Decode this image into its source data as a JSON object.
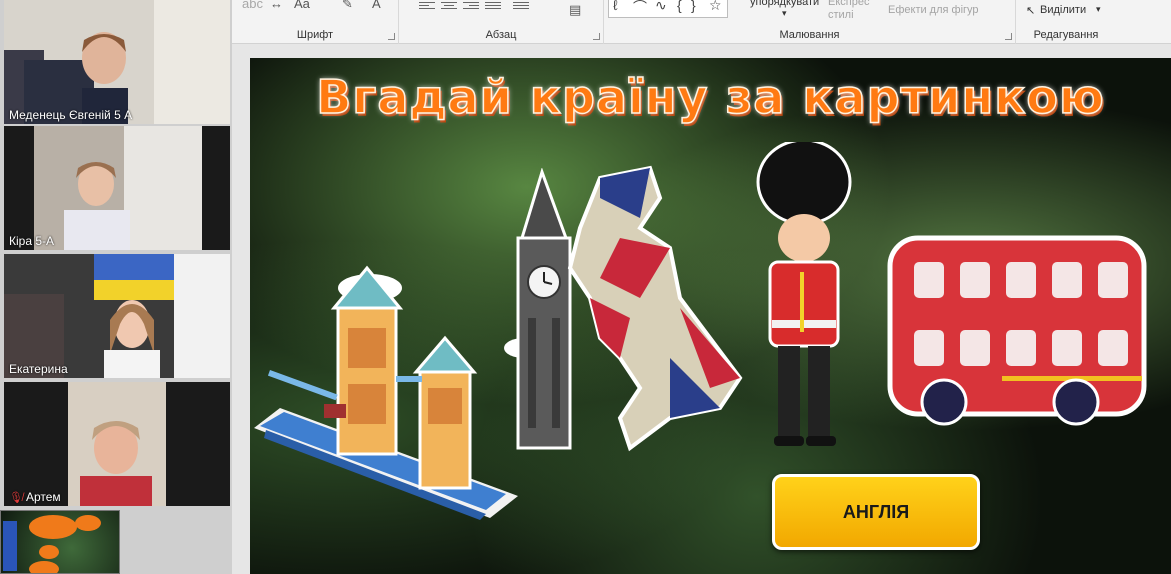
{
  "ribbon": {
    "groups": {
      "font": "Шрифт",
      "paragraph": "Абзац",
      "drawing": "Малювання",
      "editing": "Редагування"
    },
    "tools": {
      "font_case": "Aa",
      "font_color": "A",
      "arrange_label": "упорядкувати",
      "quick_styles": "Експрес стилі",
      "shape_effects": "Ефекти для фігур",
      "select": "Виділити"
    }
  },
  "participants": [
    {
      "name": "Меденець Євгеній 5 А",
      "muted": false
    },
    {
      "name": "Кіра 5-А",
      "muted": false
    },
    {
      "name": "Екатерина",
      "muted": false
    },
    {
      "name": "Артем",
      "muted": true
    }
  ],
  "slide": {
    "title": "Вгадай країну за картинкою",
    "answer_button": "АНГЛІЯ",
    "colors": {
      "title": "#ff7a12",
      "button": "#ffc60a",
      "bus": "#d8343a"
    }
  }
}
